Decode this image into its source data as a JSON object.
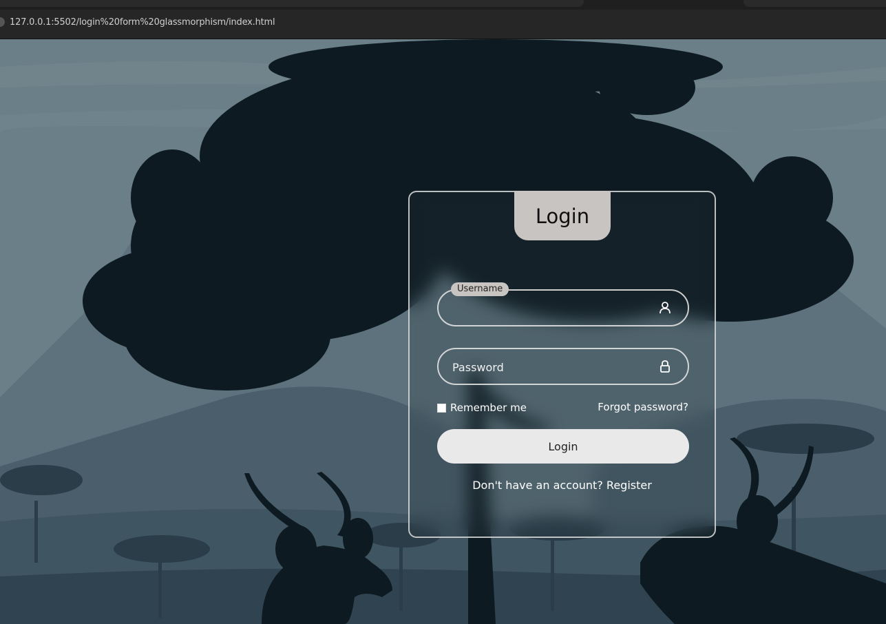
{
  "browser": {
    "url": "127.0.0.1:5502/login%20form%20glassmorphism/index.html"
  },
  "login_form": {
    "title": "Login",
    "username": {
      "label": "Username",
      "value": "",
      "icon": "user-icon"
    },
    "password": {
      "placeholder": "Password",
      "value": "",
      "icon": "lock-icon"
    },
    "remember_label": "Remember me",
    "remember_checked": false,
    "forgot_label": "Forgot password?",
    "submit_label": "Login",
    "register_prompt": "Don't have an account?",
    "register_link": "Register"
  },
  "colors": {
    "sky": "#6b7f88",
    "mountain_far": "#536873",
    "silhouette": "#0e1a21",
    "header_tab": "#c8c4c1",
    "button": "#e9e9e9"
  }
}
